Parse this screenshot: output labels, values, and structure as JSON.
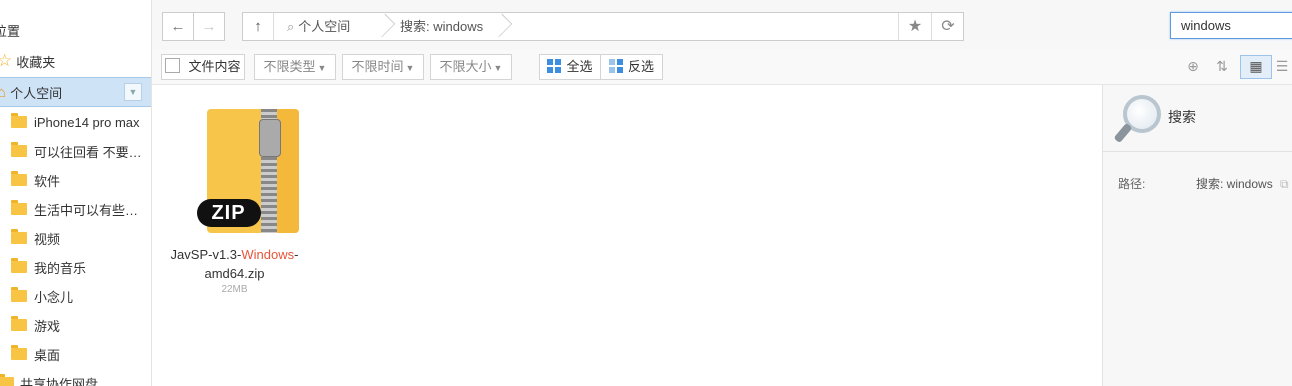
{
  "sidebar": {
    "header": "位置",
    "favorites": "收藏夹",
    "personal_space": "个人空间",
    "folders": [
      "iPhone14 pro max",
      "可以往回看 不要…",
      "软件",
      "生活中可以有些…",
      "视频",
      "我的音乐",
      "小念儿",
      "游戏",
      "桌面"
    ],
    "shared": "共享协作网盘"
  },
  "addressbar": {
    "crumbs": [
      "个人空间",
      "搜索: windows"
    ]
  },
  "search": {
    "value": "windows"
  },
  "filters": {
    "file_content": "文件内容",
    "type": "不限类型",
    "time": "不限时间",
    "size": "不限大小",
    "select_all": "全选",
    "invert": "反选"
  },
  "file": {
    "name_prefix": "JavSP-v1.3-",
    "name_highlight": "Windows",
    "name_suffix": "-",
    "name_line2": "amd64.zip",
    "size": "22MB",
    "badge": "ZIP"
  },
  "details": {
    "title": "搜索",
    "path_label": "路径:",
    "path_value": "搜索: windows"
  },
  "colors": {
    "accent": "#3d8ee0",
    "highlight": "#e5553a",
    "selection": "#cfe3f7"
  }
}
